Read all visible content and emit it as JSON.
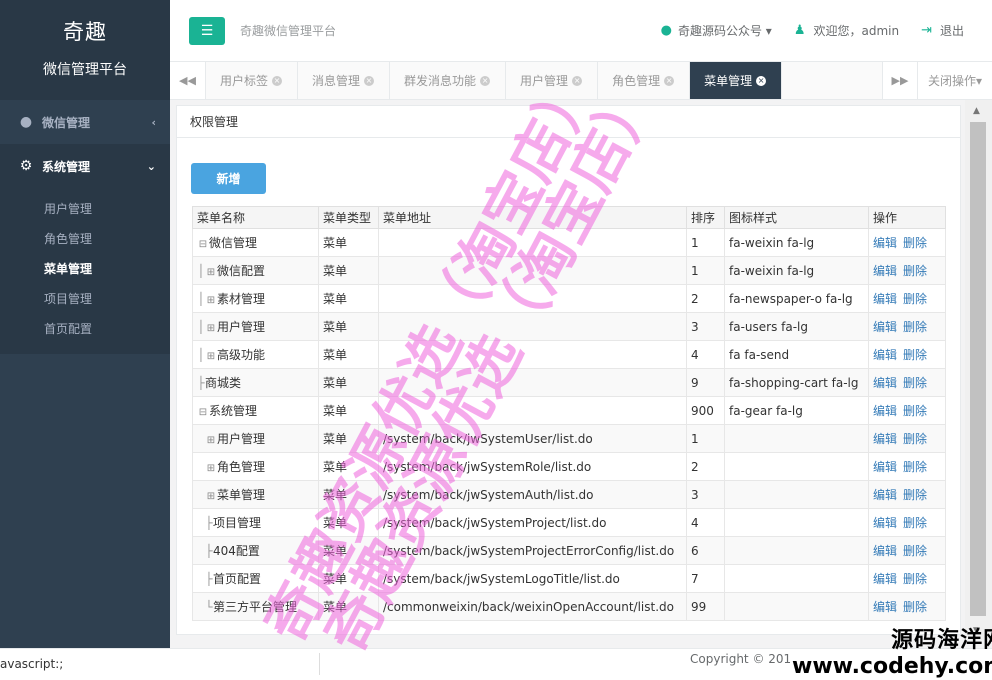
{
  "sidebar": {
    "brand_name": "奇趣",
    "brand_sub": "微信管理平台",
    "items": [
      {
        "label": "微信管理",
        "arrow": "‹"
      },
      {
        "label": "系统管理",
        "arrow": "⌄"
      }
    ],
    "sub_items": [
      "用户管理",
      "角色管理",
      "菜单管理",
      "项目管理",
      "首页配置"
    ]
  },
  "header": {
    "title": "奇趣微信管理平台",
    "wechat_label": "奇趣源码公众号",
    "welcome": "欢迎您，admin",
    "logout": "退出"
  },
  "tabs": {
    "items": [
      "用户标签",
      "消息管理",
      "群发消息功能",
      "用户管理",
      "角色管理",
      "菜单管理"
    ],
    "close_ops": "关闭操作"
  },
  "panel": {
    "title": "权限管理",
    "add_label": "新增"
  },
  "table": {
    "headers": [
      "菜单名称",
      "菜单类型",
      "菜单地址",
      "排序",
      "图标样式",
      "操作"
    ],
    "edit_label": "编辑",
    "delete_label": "删除",
    "rows": [
      {
        "name": "微信管理",
        "type": "菜单",
        "url": "",
        "sort": "1",
        "icon": "fa-weixin fa-lg"
      },
      {
        "name": "微信配置",
        "type": "菜单",
        "url": "",
        "sort": "1",
        "icon": "fa-weixin fa-lg"
      },
      {
        "name": "素材管理",
        "type": "菜单",
        "url": "",
        "sort": "2",
        "icon": "fa-newspaper-o fa-lg"
      },
      {
        "name": "用户管理",
        "type": "菜单",
        "url": "",
        "sort": "3",
        "icon": "fa-users fa-lg"
      },
      {
        "name": "高级功能",
        "type": "菜单",
        "url": "",
        "sort": "4",
        "icon": "fa fa-send"
      },
      {
        "name": "商城类",
        "type": "菜单",
        "url": "",
        "sort": "9",
        "icon": "fa-shopping-cart fa-lg"
      },
      {
        "name": "系统管理",
        "type": "菜单",
        "url": "",
        "sort": "900",
        "icon": "fa-gear fa-lg"
      },
      {
        "name": "用户管理",
        "type": "菜单",
        "url": "/system/back/jwSystemUser/list.do",
        "sort": "1",
        "icon": ""
      },
      {
        "name": "角色管理",
        "type": "菜单",
        "url": "/system/back/jwSystemRole/list.do",
        "sort": "2",
        "icon": ""
      },
      {
        "name": "菜单管理",
        "type": "菜单",
        "url": "/system/back/jwSystemAuth/list.do",
        "sort": "3",
        "icon": ""
      },
      {
        "name": "项目管理",
        "type": "菜单",
        "url": "/system/back/jwSystemProject/list.do",
        "sort": "4",
        "icon": ""
      },
      {
        "name": "404配置",
        "type": "菜单",
        "url": "/system/back/jwSystemProjectErrorConfig/list.do",
        "sort": "6",
        "icon": ""
      },
      {
        "name": "首页配置",
        "type": "菜单",
        "url": "/system/back/jwSystemLogoTitle/list.do",
        "sort": "7",
        "icon": ""
      },
      {
        "name": "第三方平台管理",
        "type": "菜单",
        "url": "/commonweixin/back/weixinOpenAccount/list.do",
        "sort": "99",
        "icon": ""
      }
    ]
  },
  "footer": {
    "status": "avascript:;",
    "copyright": "Copyright © 201"
  },
  "watermark": {
    "line1": "奇趣资源优选（淘宝店）",
    "line2": "奇趣资源优选（淘宝店）",
    "site_cn": "源码海洋网",
    "site_en": "www.codehy.com"
  },
  "colors": {
    "sidebar_bg": "#2f4050",
    "accent": "#1ab394",
    "button_blue": "#4aa4e0",
    "link": "#337ab7"
  },
  "icons": {
    "menu_toggle": "bars-icon",
    "wechat": "wechat-icon",
    "user": "user-icon",
    "logout": "sign-out-icon",
    "settings": "gear-icon"
  }
}
